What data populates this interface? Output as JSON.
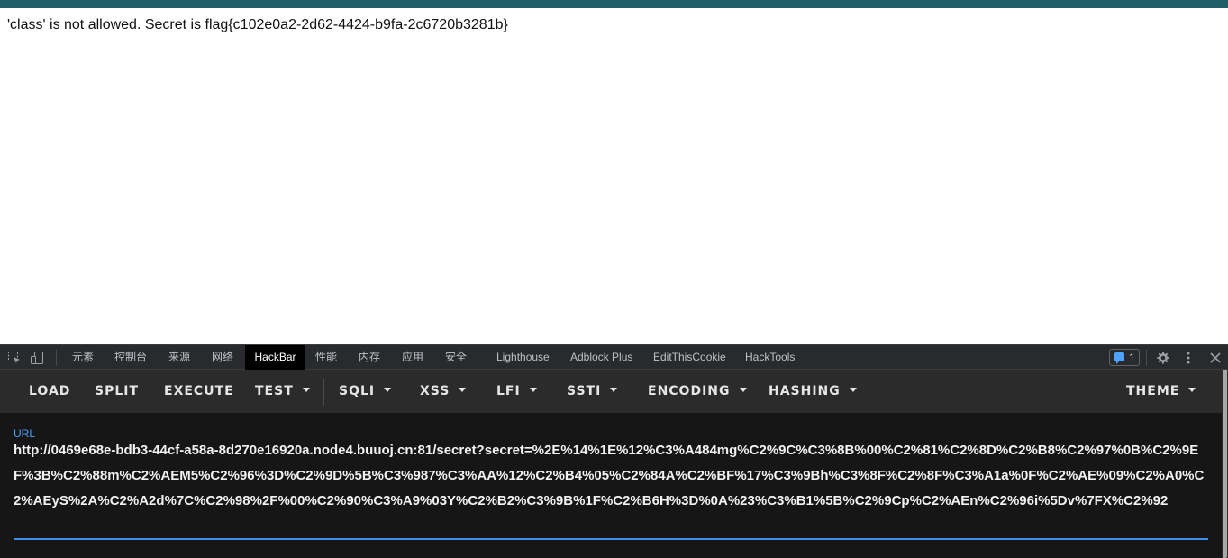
{
  "page": {
    "message": "'class' is not allowed. Secret is flag{c102e0a2-2d62-4424-b9fa-2c6720b3281b}"
  },
  "devtools": {
    "left_icons": [
      "inspect-element-icon",
      "device-toolbar-icon"
    ],
    "tabs": [
      {
        "label": "元素",
        "active": false
      },
      {
        "label": "控制台",
        "active": false
      },
      {
        "label": "来源",
        "active": false
      },
      {
        "label": "网络",
        "active": false
      },
      {
        "label": "HackBar",
        "active": true
      },
      {
        "label": "性能",
        "active": false
      },
      {
        "label": "内存",
        "active": false
      },
      {
        "label": "应用",
        "active": false
      },
      {
        "label": "安全",
        "active": false
      },
      {
        "label": "Lighthouse",
        "active": false
      },
      {
        "label": "Adblock Plus",
        "active": false
      },
      {
        "label": "EditThisCookie",
        "active": false
      },
      {
        "label": "HackTools",
        "active": false
      }
    ],
    "issues_count": "1",
    "right_icons": [
      "gear-icon",
      "more-vertical-icon",
      "close-icon"
    ]
  },
  "hackbar": {
    "buttons": [
      {
        "label": "LOAD",
        "dropdown": false
      },
      {
        "label": "SPLIT",
        "dropdown": false
      },
      {
        "label": "EXECUTE",
        "dropdown": false
      },
      {
        "label": "TEST",
        "dropdown": true
      },
      {
        "label": "SQLI",
        "dropdown": true
      },
      {
        "label": "XSS",
        "dropdown": true
      },
      {
        "label": "LFI",
        "dropdown": true
      },
      {
        "label": "SSTI",
        "dropdown": true
      },
      {
        "label": "ENCODING",
        "dropdown": true
      },
      {
        "label": "HASHING",
        "dropdown": true
      }
    ],
    "theme_label": "THEME",
    "url_label": "URL",
    "url_value": "http://0469e68e-bdb3-44cf-a58a-8d270e16920a.node4.buuoj.cn:81/secret?secret=%2E%14%1E%12%C3%A484mg%C2%9C%C3%8B%00%C2%81%C2%8D%C2%B8%C2%97%0B%C2%9EF%3B%C2%88m%C2%AEM5%C2%96%3D%C2%9D%5B%C3%987%C3%AA%12%C2%B4%05%C2%84A%C2%BF%17%C3%9Bh%C3%8F%C2%8F%C3%A1a%0F%C2%AE%09%C2%A0%C2%AEyS%2A%C2%A2d%7C%C2%98%2F%00%C2%90%C3%A9%03Y%C2%B2%C3%9B%1F%C2%B6H%3D%0A%23%C3%B1%5B%C2%9Cp%C2%AEn%C2%96i%5Dv%7FX%C2%92"
  },
  "colors": {
    "top_strip": "#1f5f66",
    "accent": "#3d8ee8",
    "devtools_bg": "#1f1f1f",
    "toolbar_bg": "#2b2b2b"
  }
}
